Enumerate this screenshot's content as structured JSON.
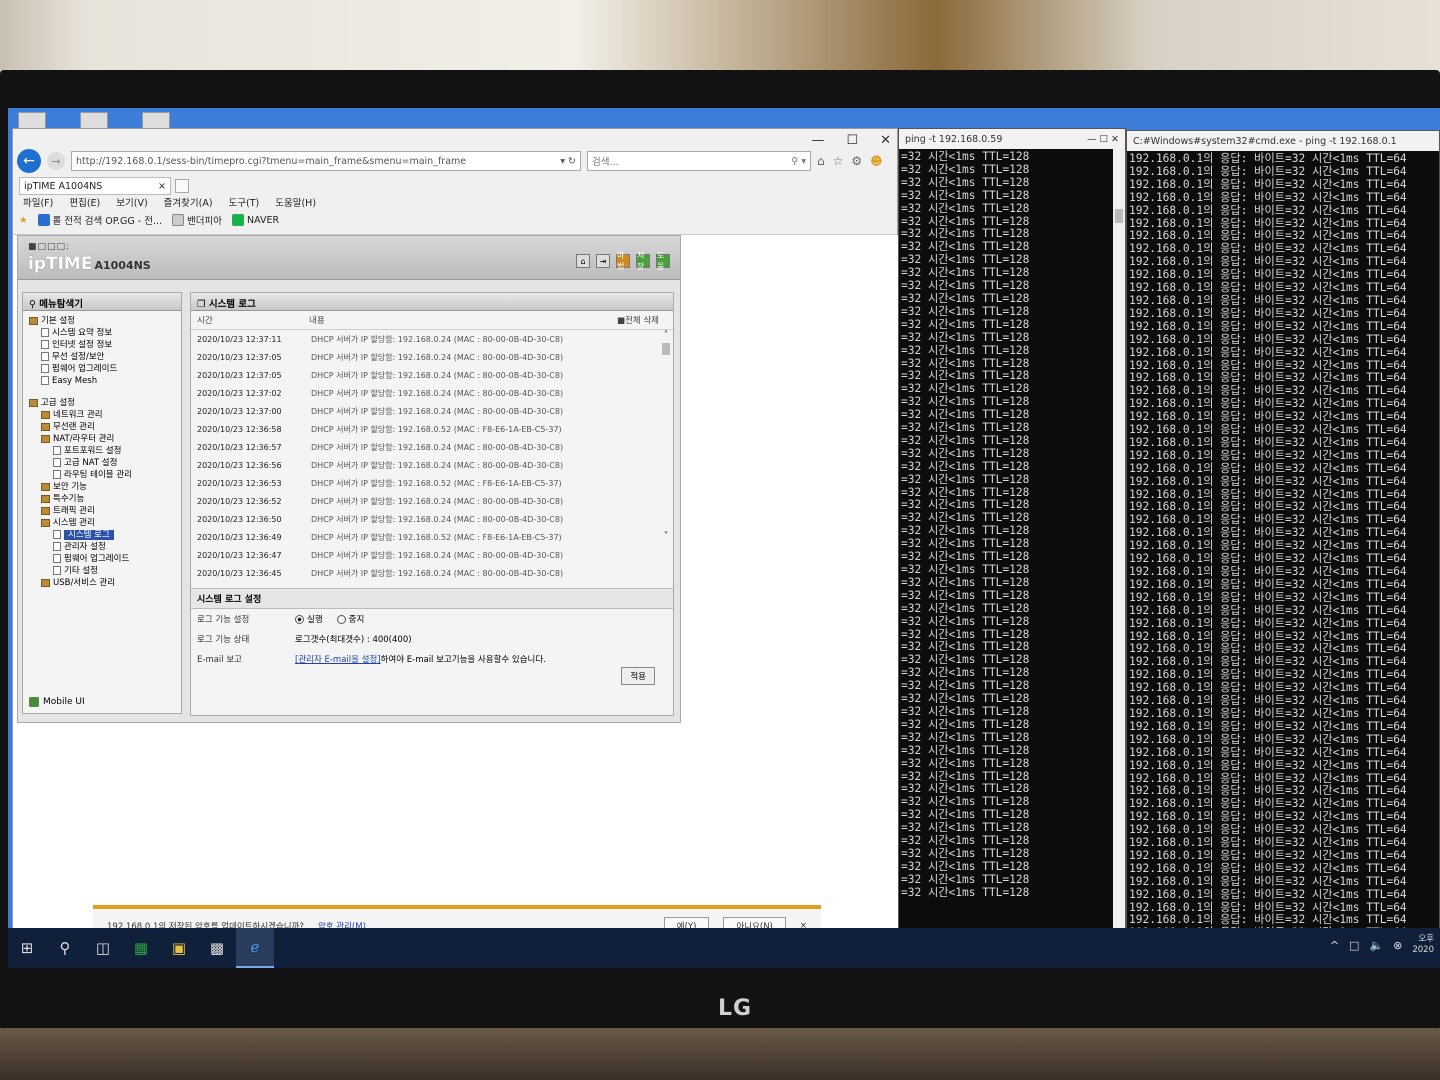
{
  "ie": {
    "window_controls": [
      "—",
      "☐",
      "✕"
    ],
    "url": "http://192.168.0.1/sess-bin/timepro.cgi?tmenu=main_frame&smenu=main_frame",
    "search_placeholder": "검색...",
    "tab_title": "ipTIME A1004NS",
    "menu": [
      "파일(F)",
      "편집(E)",
      "보기(V)",
      "즐겨찾기(A)",
      "도구(T)",
      "도움말(H)"
    ],
    "favorites": [
      "롤 전적 검색 OP.GG - 전...",
      "밴더피아",
      "NAVER"
    ]
  },
  "router": {
    "header_dots": "■□□□:",
    "brand": "ipTIME",
    "model": "A1004NS",
    "header_icons": [
      "⌂",
      "⇥",
      "마법",
      "저장",
      "도움"
    ],
    "menu_title": "메뉴탐색기",
    "tree": [
      {
        "label": "기본 설정",
        "level": 0,
        "kind": "folder"
      },
      {
        "label": "시스템 요약 정보",
        "level": 1,
        "kind": "page"
      },
      {
        "label": "인터넷 설정 정보",
        "level": 1,
        "kind": "page"
      },
      {
        "label": "무선 설정/보안",
        "level": 1,
        "kind": "page"
      },
      {
        "label": "펌웨어 업그레이드",
        "level": 1,
        "kind": "page"
      },
      {
        "label": "Easy Mesh",
        "level": 1,
        "kind": "page"
      },
      {
        "label": "",
        "level": 0,
        "kind": "gap"
      },
      {
        "label": "고급 설정",
        "level": 0,
        "kind": "folder"
      },
      {
        "label": "네트워크 관리",
        "level": 1,
        "kind": "folder"
      },
      {
        "label": "무선랜 관리",
        "level": 1,
        "kind": "folder"
      },
      {
        "label": "NAT/라우터 관리",
        "level": 1,
        "kind": "folder"
      },
      {
        "label": "포트포워드 설정",
        "level": 2,
        "kind": "page"
      },
      {
        "label": "고급 NAT 설정",
        "level": 2,
        "kind": "page"
      },
      {
        "label": "라우팅 테이블 관리",
        "level": 2,
        "kind": "page"
      },
      {
        "label": "보안 기능",
        "level": 1,
        "kind": "folder"
      },
      {
        "label": "특수기능",
        "level": 1,
        "kind": "folder"
      },
      {
        "label": "트래픽 관리",
        "level": 1,
        "kind": "folder"
      },
      {
        "label": "시스템 관리",
        "level": 1,
        "kind": "folder"
      },
      {
        "label": "시스템 로그",
        "level": 2,
        "kind": "page",
        "selected": true
      },
      {
        "label": "관리자 설정",
        "level": 2,
        "kind": "page"
      },
      {
        "label": "펌웨어 업그레이드",
        "level": 2,
        "kind": "page"
      },
      {
        "label": "기타 설정",
        "level": 2,
        "kind": "page"
      },
      {
        "label": "USB/서비스 관리",
        "level": 1,
        "kind": "folder"
      }
    ],
    "mobile_ui": "Mobile UI",
    "main_title": "시스템 로그",
    "col_time": "시간",
    "col_content": "내용",
    "delete_all": "■전체 삭제",
    "logs": [
      {
        "time": "2020/10/23 12:37:11",
        "msg": "DHCP 서버가 IP 할당함: 192.168.0.24 (MAC : 80-00-0B-4D-30-C8)"
      },
      {
        "time": "2020/10/23 12:37:05",
        "msg": "DHCP 서버가 IP 할당함: 192.168.0.24 (MAC : 80-00-0B-4D-30-C8)"
      },
      {
        "time": "2020/10/23 12:37:05",
        "msg": "DHCP 서버가 IP 할당함: 192.168.0.24 (MAC : 80-00-0B-4D-30-C8)"
      },
      {
        "time": "2020/10/23 12:37:02",
        "msg": "DHCP 서버가 IP 할당함: 192.168.0.24 (MAC : 80-00-0B-4D-30-C8)"
      },
      {
        "time": "2020/10/23 12:37:00",
        "msg": "DHCP 서버가 IP 할당함: 192.168.0.24 (MAC : 80-00-0B-4D-30-C8)"
      },
      {
        "time": "2020/10/23 12:36:58",
        "msg": "DHCP 서버가 IP 할당함: 192.168.0.52 (MAC : F8-E6-1A-EB-C5-37)"
      },
      {
        "time": "2020/10/23 12:36:57",
        "msg": "DHCP 서버가 IP 할당함: 192.168.0.24 (MAC : 80-00-0B-4D-30-C8)"
      },
      {
        "time": "2020/10/23 12:36:56",
        "msg": "DHCP 서버가 IP 할당함: 192.168.0.24 (MAC : 80-00-0B-4D-30-C8)"
      },
      {
        "time": "2020/10/23 12:36:53",
        "msg": "DHCP 서버가 IP 할당함: 192.168.0.52 (MAC : F8-E6-1A-EB-C5-37)"
      },
      {
        "time": "2020/10/23 12:36:52",
        "msg": "DHCP 서버가 IP 할당함: 192.168.0.24 (MAC : 80-00-0B-4D-30-C8)"
      },
      {
        "time": "2020/10/23 12:36:50",
        "msg": "DHCP 서버가 IP 할당함: 192.168.0.24 (MAC : 80-00-0B-4D-30-C8)"
      },
      {
        "time": "2020/10/23 12:36:49",
        "msg": "DHCP 서버가 IP 할당함: 192.168.0.52 (MAC : F8-E6-1A-EB-C5-37)"
      },
      {
        "time": "2020/10/23 12:36:47",
        "msg": "DHCP 서버가 IP 할당함: 192.168.0.24 (MAC : 80-00-0B-4D-30-C8)"
      },
      {
        "time": "2020/10/23 12:36:45",
        "msg": "DHCP 서버가 IP 할당함: 192.168.0.24 (MAC : 80-00-0B-4D-30-C8)"
      }
    ],
    "log_settings_title": "시스템 로그 설정",
    "log_func_label": "로그 기능 설정",
    "opt_run": "실행",
    "opt_stop": "중지",
    "log_state_label": "로그 기능 상태",
    "log_state_value": "로그갯수(최대갯수) : 400(400)",
    "email_label": "E-mail 보고",
    "email_link": "[관리자 E-mail을 설정]",
    "email_text": "하여야 E-mail 보고기능을 사용할수 있습니다.",
    "apply": "적용"
  },
  "notification": {
    "text": "192.168.0.1의 저장된 암호를 업데이트하시겠습니까?",
    "manage": "암호 관리(M)",
    "yes": "예(Y)",
    "no": "아니요(N)",
    "close": "×"
  },
  "cmd1": {
    "title": "ping -t 192.168.0.59",
    "line": "=32 시간<1ms TTL=128",
    "lines": 58
  },
  "cmd2": {
    "title": "C:#Windows#system32#cmd.exe - ping -t 192.168.0.1",
    "line": "192.168.0.1의 응답: 바이트=32 시간<1ms TTL=64",
    "lines": 61
  },
  "taskbar": {
    "clock": "오후\n2020"
  },
  "monitor_brand": "LG"
}
